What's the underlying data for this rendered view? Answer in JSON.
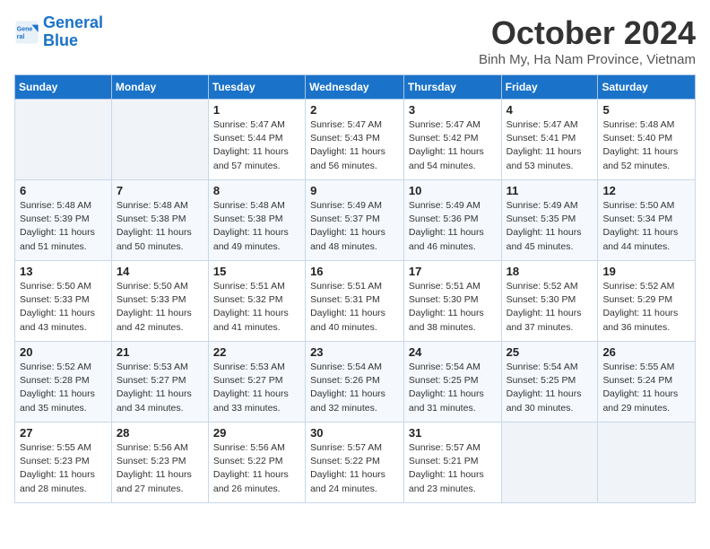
{
  "logo": {
    "line1": "General",
    "line2": "Blue"
  },
  "title": "October 2024",
  "location": "Binh My, Ha Nam Province, Vietnam",
  "weekdays": [
    "Sunday",
    "Monday",
    "Tuesday",
    "Wednesday",
    "Thursday",
    "Friday",
    "Saturday"
  ],
  "weeks": [
    [
      {
        "day": "",
        "info": ""
      },
      {
        "day": "",
        "info": ""
      },
      {
        "day": "1",
        "info": "Sunrise: 5:47 AM\nSunset: 5:44 PM\nDaylight: 11 hours and 57 minutes."
      },
      {
        "day": "2",
        "info": "Sunrise: 5:47 AM\nSunset: 5:43 PM\nDaylight: 11 hours and 56 minutes."
      },
      {
        "day": "3",
        "info": "Sunrise: 5:47 AM\nSunset: 5:42 PM\nDaylight: 11 hours and 54 minutes."
      },
      {
        "day": "4",
        "info": "Sunrise: 5:47 AM\nSunset: 5:41 PM\nDaylight: 11 hours and 53 minutes."
      },
      {
        "day": "5",
        "info": "Sunrise: 5:48 AM\nSunset: 5:40 PM\nDaylight: 11 hours and 52 minutes."
      }
    ],
    [
      {
        "day": "6",
        "info": "Sunrise: 5:48 AM\nSunset: 5:39 PM\nDaylight: 11 hours and 51 minutes."
      },
      {
        "day": "7",
        "info": "Sunrise: 5:48 AM\nSunset: 5:38 PM\nDaylight: 11 hours and 50 minutes."
      },
      {
        "day": "8",
        "info": "Sunrise: 5:48 AM\nSunset: 5:38 PM\nDaylight: 11 hours and 49 minutes."
      },
      {
        "day": "9",
        "info": "Sunrise: 5:49 AM\nSunset: 5:37 PM\nDaylight: 11 hours and 48 minutes."
      },
      {
        "day": "10",
        "info": "Sunrise: 5:49 AM\nSunset: 5:36 PM\nDaylight: 11 hours and 46 minutes."
      },
      {
        "day": "11",
        "info": "Sunrise: 5:49 AM\nSunset: 5:35 PM\nDaylight: 11 hours and 45 minutes."
      },
      {
        "day": "12",
        "info": "Sunrise: 5:50 AM\nSunset: 5:34 PM\nDaylight: 11 hours and 44 minutes."
      }
    ],
    [
      {
        "day": "13",
        "info": "Sunrise: 5:50 AM\nSunset: 5:33 PM\nDaylight: 11 hours and 43 minutes."
      },
      {
        "day": "14",
        "info": "Sunrise: 5:50 AM\nSunset: 5:33 PM\nDaylight: 11 hours and 42 minutes."
      },
      {
        "day": "15",
        "info": "Sunrise: 5:51 AM\nSunset: 5:32 PM\nDaylight: 11 hours and 41 minutes."
      },
      {
        "day": "16",
        "info": "Sunrise: 5:51 AM\nSunset: 5:31 PM\nDaylight: 11 hours and 40 minutes."
      },
      {
        "day": "17",
        "info": "Sunrise: 5:51 AM\nSunset: 5:30 PM\nDaylight: 11 hours and 38 minutes."
      },
      {
        "day": "18",
        "info": "Sunrise: 5:52 AM\nSunset: 5:30 PM\nDaylight: 11 hours and 37 minutes."
      },
      {
        "day": "19",
        "info": "Sunrise: 5:52 AM\nSunset: 5:29 PM\nDaylight: 11 hours and 36 minutes."
      }
    ],
    [
      {
        "day": "20",
        "info": "Sunrise: 5:52 AM\nSunset: 5:28 PM\nDaylight: 11 hours and 35 minutes."
      },
      {
        "day": "21",
        "info": "Sunrise: 5:53 AM\nSunset: 5:27 PM\nDaylight: 11 hours and 34 minutes."
      },
      {
        "day": "22",
        "info": "Sunrise: 5:53 AM\nSunset: 5:27 PM\nDaylight: 11 hours and 33 minutes."
      },
      {
        "day": "23",
        "info": "Sunrise: 5:54 AM\nSunset: 5:26 PM\nDaylight: 11 hours and 32 minutes."
      },
      {
        "day": "24",
        "info": "Sunrise: 5:54 AM\nSunset: 5:25 PM\nDaylight: 11 hours and 31 minutes."
      },
      {
        "day": "25",
        "info": "Sunrise: 5:54 AM\nSunset: 5:25 PM\nDaylight: 11 hours and 30 minutes."
      },
      {
        "day": "26",
        "info": "Sunrise: 5:55 AM\nSunset: 5:24 PM\nDaylight: 11 hours and 29 minutes."
      }
    ],
    [
      {
        "day": "27",
        "info": "Sunrise: 5:55 AM\nSunset: 5:23 PM\nDaylight: 11 hours and 28 minutes."
      },
      {
        "day": "28",
        "info": "Sunrise: 5:56 AM\nSunset: 5:23 PM\nDaylight: 11 hours and 27 minutes."
      },
      {
        "day": "29",
        "info": "Sunrise: 5:56 AM\nSunset: 5:22 PM\nDaylight: 11 hours and 26 minutes."
      },
      {
        "day": "30",
        "info": "Sunrise: 5:57 AM\nSunset: 5:22 PM\nDaylight: 11 hours and 24 minutes."
      },
      {
        "day": "31",
        "info": "Sunrise: 5:57 AM\nSunset: 5:21 PM\nDaylight: 11 hours and 23 minutes."
      },
      {
        "day": "",
        "info": ""
      },
      {
        "day": "",
        "info": ""
      }
    ]
  ]
}
